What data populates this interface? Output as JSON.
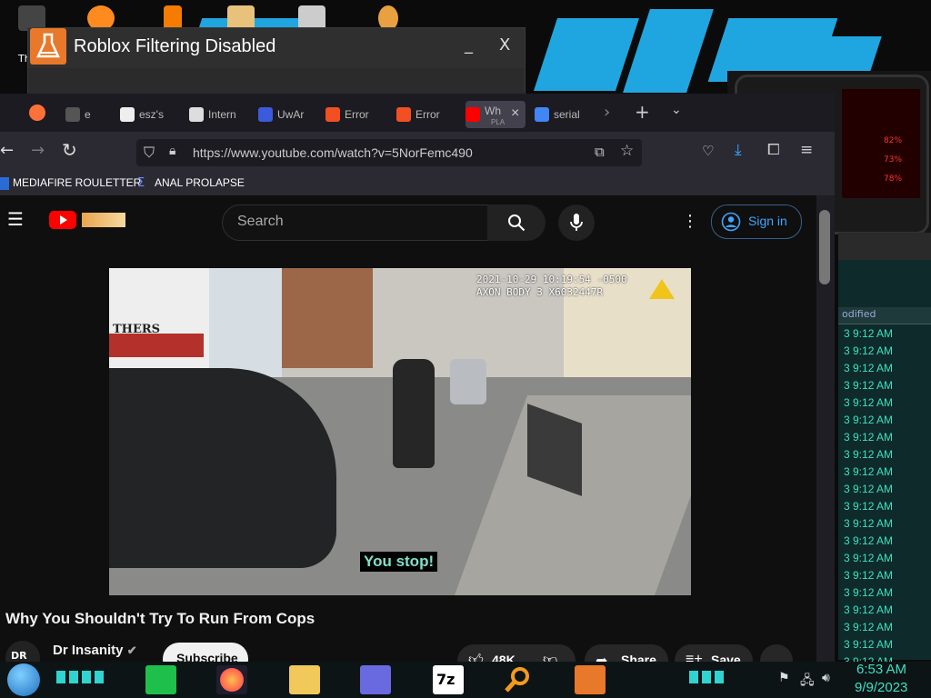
{
  "desktop": {
    "icon_label_partial": "Th"
  },
  "roblox_window": {
    "title": "Roblox Filtering Disabled",
    "minimize": "_",
    "close": "X"
  },
  "hud": {
    "readouts": [
      "82%",
      "73%",
      "78%"
    ]
  },
  "explorer": {
    "column_header": "odified",
    "rows": [
      "3 9:12 AM",
      "3 9:12 AM",
      "3 9:12 AM",
      "3 9:12 AM",
      "3 9:12 AM",
      "3 9:12 AM",
      "3 9:12 AM",
      "3 9:12 AM",
      "3 9:12 AM",
      "3 9:12 AM",
      "3 9:12 AM",
      "3 9:12 AM",
      "3 9:12 AM",
      "3 9:12 AM",
      "3 9:12 AM",
      "3 9:12 AM",
      "3 9:12 AM",
      "3 9:12 AM",
      "3 9:12 AM",
      "3 9:12 AM"
    ]
  },
  "browser": {
    "tabs": [
      {
        "label": "e",
        "color": "#555"
      },
      {
        "label": "esz's",
        "color": "#eee"
      },
      {
        "label": "Intern",
        "color": "#ddd"
      },
      {
        "label": "UwAr",
        "color": "#3b5bdb"
      },
      {
        "label": "Error",
        "color": "#f25022"
      },
      {
        "label": "Error",
        "color": "#f25022"
      },
      {
        "label": "Wh",
        "sub": "PLA",
        "color": "#ff0000"
      },
      {
        "label": "serial",
        "color": "#4285f4"
      }
    ],
    "url": "https://www.youtube.com/watch?v=5NorFemc490",
    "bookmarks": [
      {
        "label": "MEDIAFIRE ROULETTER"
      },
      {
        "label": "ANAL PROLAPSE"
      }
    ]
  },
  "youtube": {
    "search_placeholder": "Search",
    "sign_in": "Sign in",
    "video": {
      "timestamp": "2021-10-29 10:19:54 -0500",
      "device": "AXON BODY 3 X6032447R",
      "shop_sign": "THERS",
      "subtitle": "You stop!"
    },
    "title": "Why You Shouldn't Try To Run From Cops",
    "channel": "Dr Insanity",
    "subscribe": "Subscribe",
    "likes": "48K",
    "share": "Share",
    "save": "Save"
  },
  "taskbar": {
    "time": "6:53 AM",
    "date": "9/9/2023"
  }
}
